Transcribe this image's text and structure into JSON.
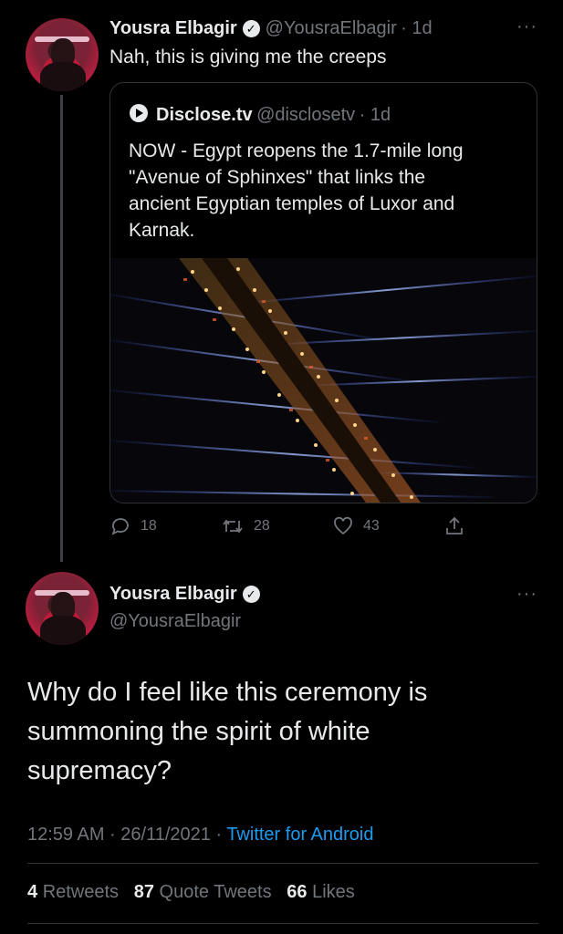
{
  "tweet1": {
    "author_name": "Yousra Elbagir",
    "author_handle": "@YousraElbagir",
    "time": "· 1d",
    "text": "Nah, this is giving me the creeps",
    "more_icon": "more-horizontal-icon",
    "quote": {
      "author_name": "Disclose.tv",
      "author_handle": "@disclosetv",
      "time": "· 1d",
      "text_lines": [
        "NOW - Egypt reopens the 1.7-mile long",
        "\"Avenue of Sphinxes\" that links the",
        "ancient Egyptian temples of Luxor and",
        "Karnak."
      ]
    },
    "actions": {
      "replies": "18",
      "retweets": "28",
      "likes": "43"
    }
  },
  "tweet2": {
    "author_name": "Yousra Elbagir",
    "author_handle": "@YousraElbagir",
    "text_lines": [
      "Why do I feel like this ceremony is",
      "summoning the spirit of white",
      "supremacy?"
    ],
    "timestamp": "12:59 AM · 26/11/2021 · ",
    "source": "Twitter for Android",
    "stats": {
      "retweets_count": "4",
      "retweets_label": "Retweets",
      "quotes_count": "87",
      "quotes_label": "Quote Tweets",
      "likes_count": "66",
      "likes_label": "Likes"
    }
  },
  "colors": {
    "background": "#000000",
    "text": "#e7e9ea",
    "secondary": "#71767b",
    "link": "#1d9bf0",
    "border": "#2f3336"
  }
}
